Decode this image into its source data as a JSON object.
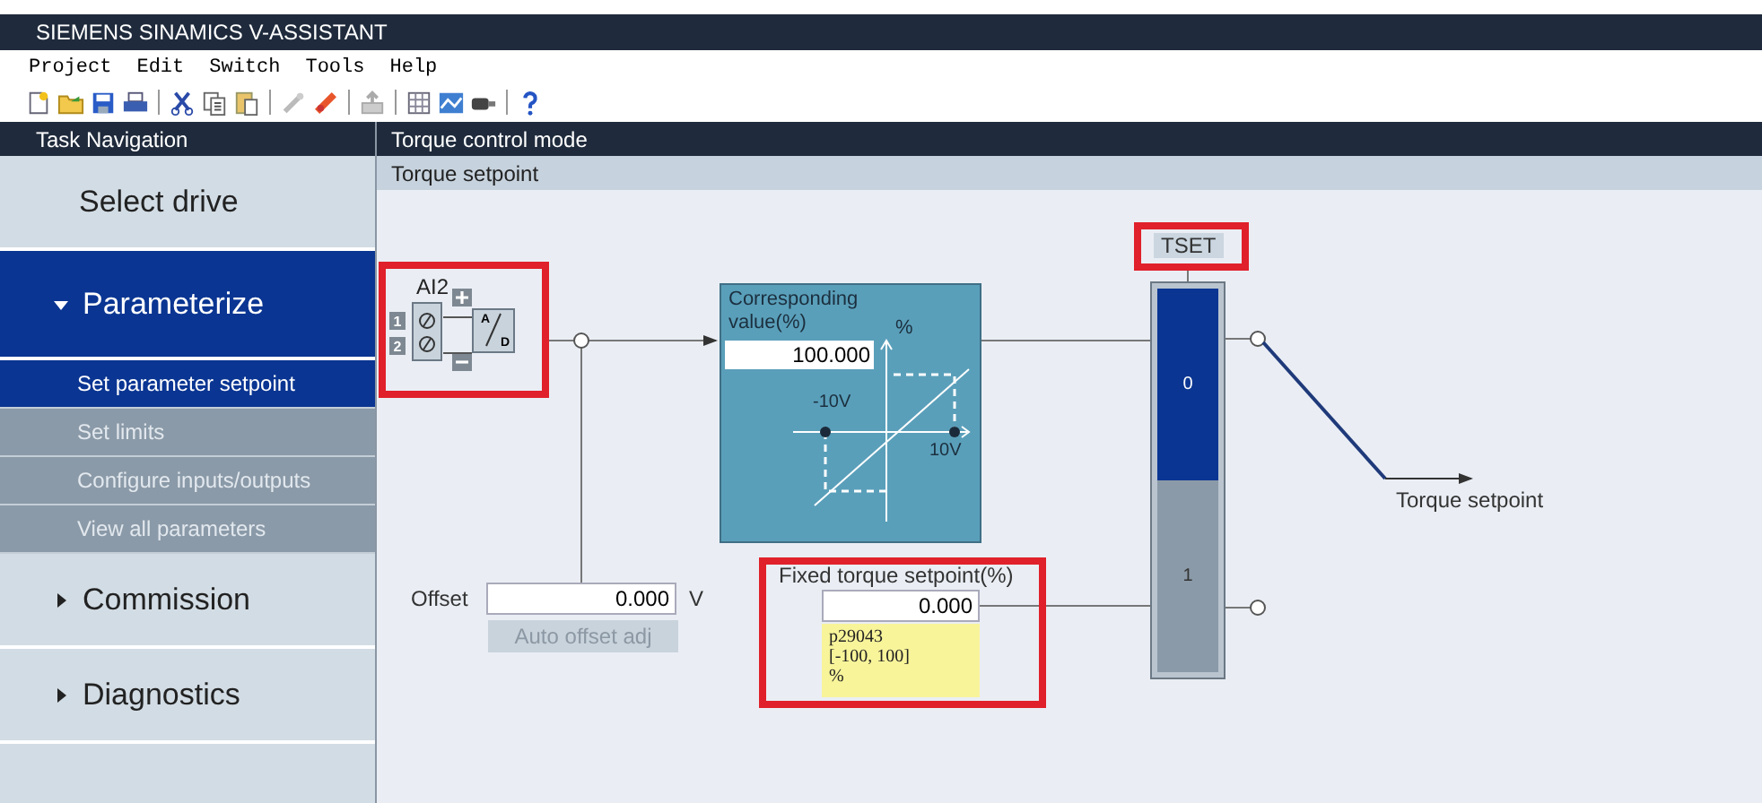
{
  "window": {
    "title": "SIEMENS SINAMICS V-ASSISTANT"
  },
  "menu": [
    "Project",
    "Edit",
    "Switch",
    "Tools",
    "Help"
  ],
  "navigation": {
    "title": "Task Navigation",
    "items": [
      {
        "label": "Select drive",
        "kind": "page",
        "selected": false
      },
      {
        "label": "Parameterize",
        "kind": "group",
        "selected": true,
        "expanded": true,
        "children": [
          {
            "label": "Set parameter setpoint",
            "selected": true
          },
          {
            "label": "Set limits",
            "selected": false
          },
          {
            "label": "Configure inputs/outputs",
            "selected": false
          },
          {
            "label": "View all parameters",
            "selected": false
          }
        ]
      },
      {
        "label": "Commission",
        "kind": "group",
        "selected": false,
        "expanded": false
      },
      {
        "label": "Diagnostics",
        "kind": "group",
        "selected": false,
        "expanded": false
      }
    ]
  },
  "main": {
    "header": "Torque control mode",
    "subheader": "Torque setpoint",
    "diagram": {
      "analog_input": {
        "label": "AI2",
        "terminals": [
          "1",
          "2"
        ],
        "converter": [
          "A",
          "D"
        ]
      },
      "scaling": {
        "title": "Corresponding value(%)",
        "value": "100.000",
        "unit": "%",
        "neg_label": "-10V",
        "pos_label": "10V"
      },
      "offset": {
        "label": "Offset",
        "value": "0.000",
        "unit": "V",
        "button": {
          "label": "Auto offset adj",
          "disabled": true
        }
      },
      "fixed_setpoint": {
        "label": "Fixed torque setpoint(%)",
        "value": "0.000",
        "tooltip": [
          "p29043",
          "[-100, 100]",
          "%"
        ]
      },
      "selector": {
        "label": "TSET",
        "positions": [
          {
            "label": "0",
            "selected": true
          },
          {
            "label": "1",
            "selected": false
          }
        ]
      },
      "output": "Torque setpoint"
    }
  }
}
